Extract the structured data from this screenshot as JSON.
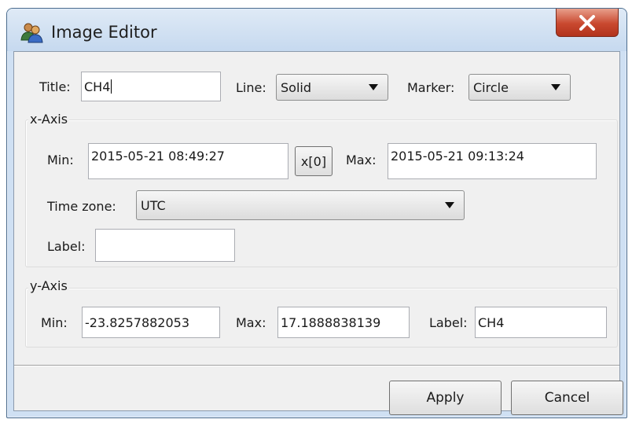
{
  "window": {
    "title": "Image Editor",
    "icon": "users-icon"
  },
  "general": {
    "title_label": "Title:",
    "title_value": "CH4",
    "line_label": "Line:",
    "line_value": "Solid",
    "marker_label": "Marker:",
    "marker_value": "Circle"
  },
  "x_axis": {
    "group_label": "x-Axis",
    "min_label": "Min:",
    "min_value": "2015-05-21 08:49:27",
    "x0_button": "x[0]",
    "max_label": "Max:",
    "max_value": "2015-05-21 09:13:24",
    "timezone_label": "Time zone:",
    "timezone_value": "UTC",
    "label_label": "Label:",
    "label_value": ""
  },
  "y_axis": {
    "group_label": "y-Axis",
    "min_label": "Min:",
    "min_value": "-23.8257882053",
    "max_label": "Max:",
    "max_value": "17.1888838139",
    "label_label": "Label:",
    "label_value": "CH4"
  },
  "buttons": {
    "apply": "Apply",
    "cancel": "Cancel"
  },
  "colors": {
    "close_button": "#c9482f",
    "client_bg": "#f0f0f0",
    "frame": "#cfe0f3"
  }
}
